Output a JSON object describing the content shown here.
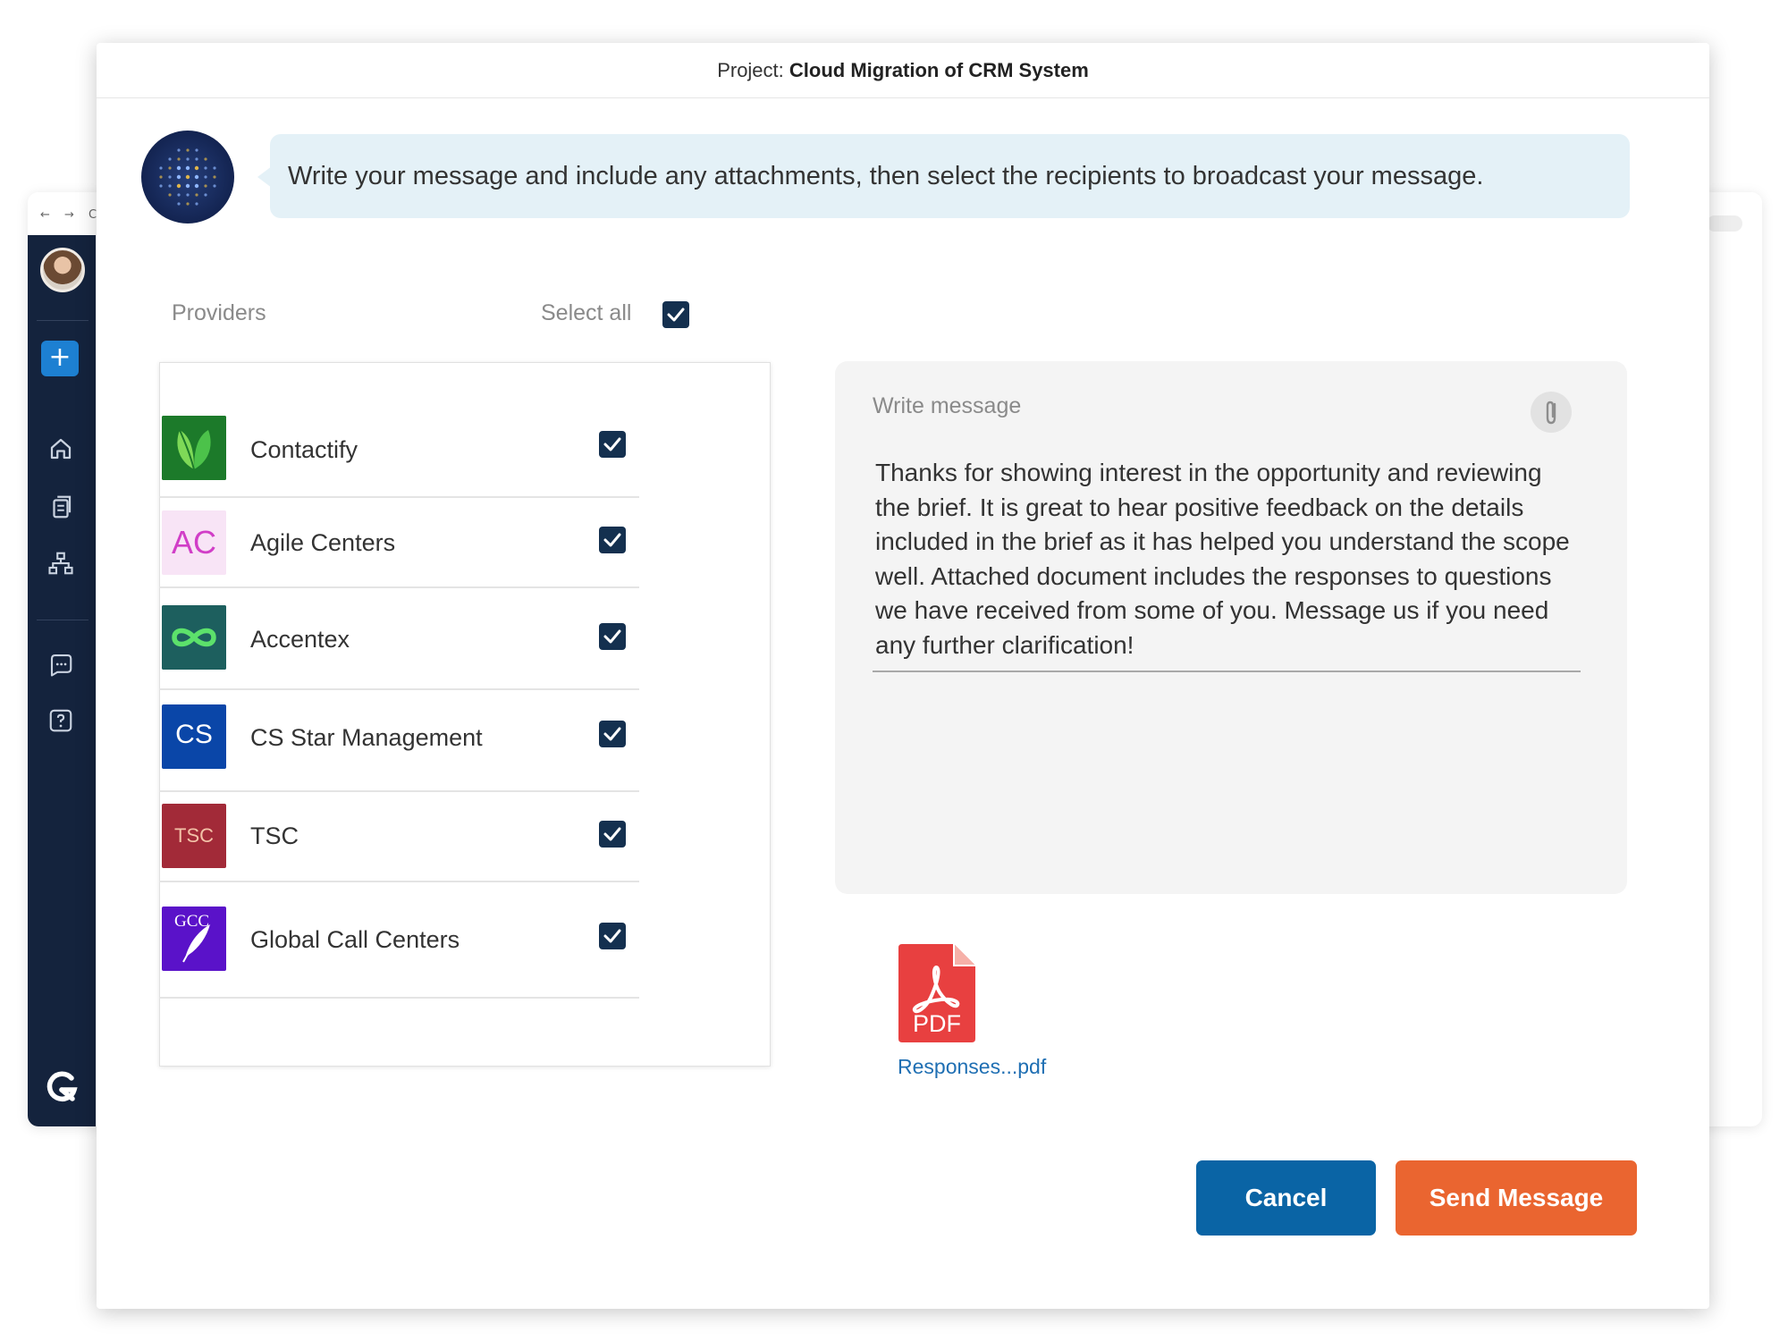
{
  "browser": {
    "nav_glyphs": "← → C"
  },
  "sidebar": {
    "add_label": "+",
    "icons": [
      "home-icon",
      "documents-icon",
      "org-chart-icon",
      "chat-icon",
      "help-icon"
    ],
    "brand_letter": "G"
  },
  "modal": {
    "project_prefix": "Project:",
    "project_name": "Cloud Migration of CRM System",
    "instruction": "Write your message and include any attachments, then select the recipients to broadcast your message."
  },
  "providers": {
    "label": "Providers",
    "select_all_label": "Select all",
    "select_all_checked": true,
    "items": [
      {
        "name": "Contactify",
        "logo_text": "",
        "logo_icon": "leaf-icon",
        "logo_bg": "#1c7a2a",
        "checked": true
      },
      {
        "name": "Agile Centers",
        "logo_text": "AC",
        "logo_bg": "#f8e4f6",
        "logo_fg": "#d13ec7",
        "checked": true
      },
      {
        "name": "Accentex",
        "logo_text": "",
        "logo_icon": "infinity-icon",
        "logo_bg": "#1d5f5e",
        "checked": true
      },
      {
        "name": "CS Star Management",
        "logo_text": "CS",
        "logo_bg": "#0a46a8",
        "logo_fg": "#ffffff",
        "checked": true
      },
      {
        "name": "TSC",
        "logo_text": "TSC",
        "logo_bg": "#a22a38",
        "logo_fg": "#f3c2a8",
        "checked": true
      },
      {
        "name": "Global Call Centers",
        "logo_text": "GCC",
        "logo_icon": "feather-icon",
        "logo_bg": "#5a12c9",
        "logo_fg": "#ffffff",
        "checked": true
      }
    ]
  },
  "message": {
    "label": "Write message",
    "body": "Thanks for showing interest in the opportunity and reviewing the brief. It is great to hear positive feedback on the details included in the brief as it has helped you understand the scope well. Attached document includes the responses to questions we have received from some of you. Message us if you need any further clarification!"
  },
  "attachment": {
    "badge": "PDF",
    "filename": "Responses...pdf"
  },
  "actions": {
    "cancel_label": "Cancel",
    "send_label": "Send Message"
  },
  "colors": {
    "sidebar": "#14233d",
    "checkbox": "#14304f",
    "cancel": "#0a64a5",
    "send": "#ea6530",
    "bubble": "#e4f1f7",
    "pdf": "#e84040",
    "link": "#1f6fb3"
  }
}
